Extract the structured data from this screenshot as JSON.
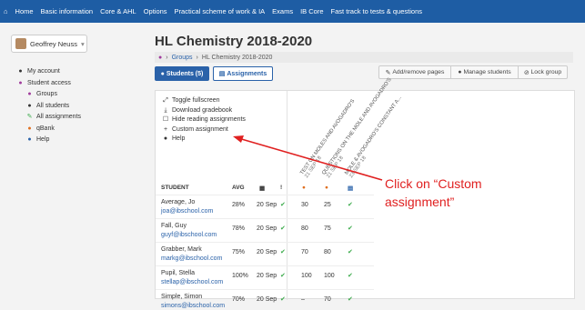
{
  "topnav": {
    "home_icon": "home-icon",
    "items": [
      "Home",
      "Basic information",
      "Core & AHL",
      "Options",
      "Practical scheme of work & IA",
      "Exams",
      "IB Core",
      "Fast track to tests & questions"
    ]
  },
  "user": {
    "name": "Geoffrey Neuss",
    "caret": "▾"
  },
  "sidebar": {
    "items": [
      {
        "label": "My account",
        "icon": "user-icon"
      },
      {
        "label": "Student access",
        "icon": "users-icon"
      },
      {
        "label": "Groups",
        "icon": "users-icon"
      },
      {
        "label": "All students",
        "icon": "user-icon"
      },
      {
        "label": "All assignments",
        "icon": "pencil-icon"
      },
      {
        "label": "qBank",
        "icon": "q-icon"
      },
      {
        "label": "Help",
        "icon": "info-icon"
      }
    ]
  },
  "page": {
    "title": "HL Chemistry 2018-2020",
    "breadcrumb": [
      "Groups",
      "HL Chemistry 2018-2020"
    ]
  },
  "tabs": {
    "students": "Students (5)",
    "assignments": "Assignments"
  },
  "actions": {
    "add_remove": "Add/remove pages",
    "manage": "Manage students",
    "lock": "Lock group"
  },
  "panel_menu": [
    {
      "label": "Toggle fullscreen",
      "icon": "expand-icon"
    },
    {
      "label": "Download gradebook",
      "icon": "download-icon"
    },
    {
      "label": "Hide reading assignments",
      "icon": "checkbox-icon"
    },
    {
      "label": "Custom assignment",
      "icon": "plus-icon"
    },
    {
      "label": "Help",
      "icon": "info-icon"
    }
  ],
  "table": {
    "headers": {
      "student": "STUDENT",
      "avg": "AVG",
      "date_icon": "calendar-icon",
      "flag": "!"
    },
    "assignment_headers": [
      {
        "title": "TEST ON MOLES AND AVOGADRO'S",
        "date": "21 SEP 18"
      },
      {
        "title": "QUESTIONS ON THE MOLE AND AVOGADRO'S",
        "date": "21 SEP 18"
      },
      {
        "title": "MOLE & AVOGADRO'S CONSTANT A...",
        "date": "23 SEP 18"
      }
    ],
    "rows": [
      {
        "name": "Average, Jo",
        "email": "joa@ibschool.com",
        "avg": "28%",
        "date": "20 Sep",
        "s1": "30",
        "s2": "25"
      },
      {
        "name": "Fall, Guy",
        "email": "guyf@ibschool.com",
        "avg": "78%",
        "date": "20 Sep",
        "s1": "80",
        "s2": "75"
      },
      {
        "name": "Grabber, Mark",
        "email": "markg@ibschool.com",
        "avg": "75%",
        "date": "20 Sep",
        "s1": "70",
        "s2": "80"
      },
      {
        "name": "Pupil, Stella",
        "email": "stellap@ibschool.com",
        "avg": "100%",
        "date": "20 Sep",
        "s1": "100",
        "s2": "100"
      },
      {
        "name": "Simple, Simon",
        "email": "simons@ibschool.com",
        "avg": "70%",
        "date": "20 Sep",
        "s1": "–",
        "s2": "70"
      }
    ],
    "tick": "✔"
  },
  "annotation": {
    "line1": "Click on “Custom",
    "line2": "assignment”",
    "color": "#e02020"
  },
  "colors": {
    "nav": "#1e5da4",
    "accent": "#2a62a9",
    "tick": "#3aaa4a"
  }
}
